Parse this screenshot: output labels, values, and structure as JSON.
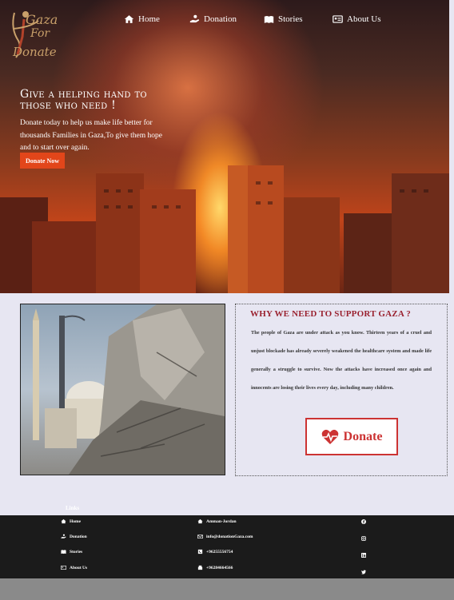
{
  "logo": {
    "line1": "Gaza",
    "line2": "For",
    "line3": "Donate"
  },
  "nav": {
    "home": "Home",
    "donation": "Donation",
    "stories": "Stories",
    "about": "About Us"
  },
  "hero": {
    "title": "Give a helping hand to those who need !",
    "text": "Donate today to help us make life better for thousands Families in Gaza,To give them hope and to start over again.",
    "button": "Donate Now"
  },
  "why": {
    "title": "WHY WE NEED TO SUPPORT GAZA ?",
    "text": "The people of Gaza are under attack as you know. Thirteen years of a cruel and unjust blockade has already severely weakened the healthcare system and made life generally a struggle to survive. Now the attacks have increased once again and innocents are losing their lives every day, including many children.",
    "donate_button": "Donate"
  },
  "footer": {
    "links_label": "Links",
    "links": [
      "Home",
      "Donation",
      "Stories",
      "About Us"
    ],
    "contact": {
      "location": "Amman-Jordan",
      "email": "info@donationGaza.com",
      "phone1": "+96255556754",
      "phone2": "+96284664566"
    }
  },
  "colors": {
    "accent": "#e2461a",
    "title_red": "#9a2230",
    "footer_bg": "#1b1b1b",
    "page_bg": "#e7e6f2"
  }
}
